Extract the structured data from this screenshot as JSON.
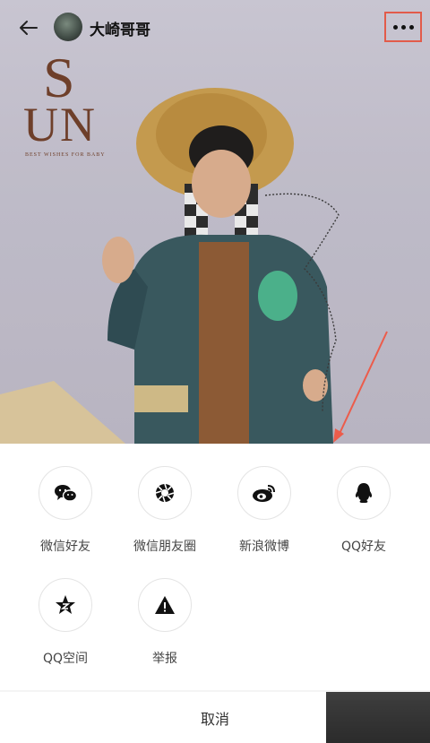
{
  "header": {
    "username": "大崎哥哥",
    "back_icon": "back-arrow-icon",
    "more_icon": "more-dots-icon",
    "highlight_color": "#e25b4a"
  },
  "photo": {
    "brand_big_s": "S",
    "brand_big_un": "UN",
    "brand_subtitle": "BEST WISHES FOR BABY"
  },
  "share_sheet": {
    "items": [
      {
        "label": "微信好友",
        "icon": "wechat-icon"
      },
      {
        "label": "微信朋友圈",
        "icon": "moments-icon"
      },
      {
        "label": "新浪微博",
        "icon": "weibo-icon"
      },
      {
        "label": "QQ好友",
        "icon": "qq-icon"
      },
      {
        "label": "QQ空间",
        "icon": "qzone-icon"
      },
      {
        "label": "举报",
        "icon": "report-icon"
      }
    ],
    "cancel_label": "取消"
  }
}
